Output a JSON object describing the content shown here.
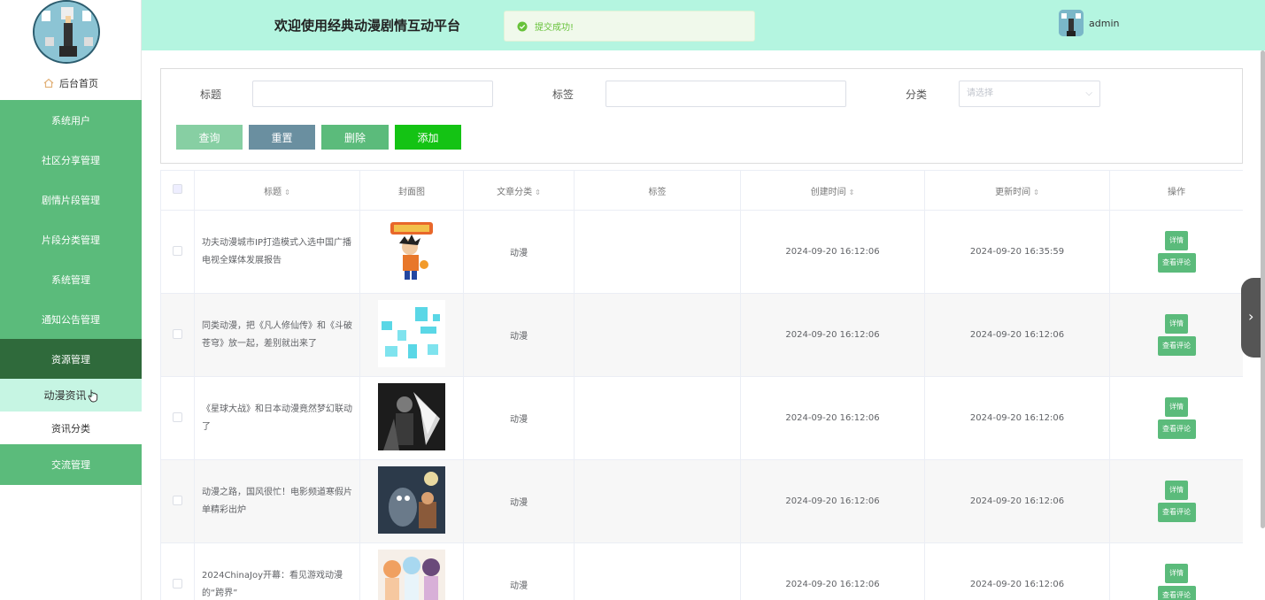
{
  "header": {
    "title": "欢迎使用经典动漫剧情互动平台",
    "toast": "提交成功!",
    "user": "admin"
  },
  "sidebar": {
    "home": "后台首页",
    "menu": [
      "系统用户",
      "社区分享管理",
      "剧情片段管理",
      "片段分类管理",
      "系统管理",
      "通知公告管理"
    ],
    "active_menu": "资源管理",
    "submenu": [
      "动漫资讯",
      "资讯分类"
    ],
    "last_menu": "交流管理"
  },
  "search": {
    "title_label": "标题",
    "tag_label": "标签",
    "category_label": "分类",
    "category_placeholder": "请选择",
    "buttons": {
      "query": "查询",
      "reset": "重置",
      "delete": "删除",
      "add": "添加"
    }
  },
  "table": {
    "headers": [
      "标题",
      "封面图",
      "文章分类",
      "标签",
      "创建时间",
      "更新时间",
      "操作"
    ],
    "rows": [
      {
        "title": "功夫动漫城市IP打造模式入选中国广播电视全媒体发展报告",
        "category": "动漫",
        "tag": "",
        "created": "2024-09-20 16:12:06",
        "updated": "2024-09-20 16:35:59"
      },
      {
        "title": "同类动漫，把《凡人修仙传》和《斗破苍穹》放一起，差别就出来了",
        "category": "动漫",
        "tag": "",
        "created": "2024-09-20 16:12:06",
        "updated": "2024-09-20 16:12:06"
      },
      {
        "title": "《星球大战》和日本动漫竟然梦幻联动了",
        "category": "动漫",
        "tag": "",
        "created": "2024-09-20 16:12:06",
        "updated": "2024-09-20 16:12:06"
      },
      {
        "title": "动漫之路，国风很忙！电影频道寒假片单精彩出炉",
        "category": "动漫",
        "tag": "",
        "created": "2024-09-20 16:12:06",
        "updated": "2024-09-20 16:12:06"
      },
      {
        "title": "2024ChinaJoy开幕：看见游戏动漫的“跨界”",
        "category": "动漫",
        "tag": "",
        "created": "2024-09-20 16:12:06",
        "updated": "2024-09-20 16:12:06"
      }
    ],
    "action_detail": "详情",
    "action_comments": "查看评论"
  }
}
